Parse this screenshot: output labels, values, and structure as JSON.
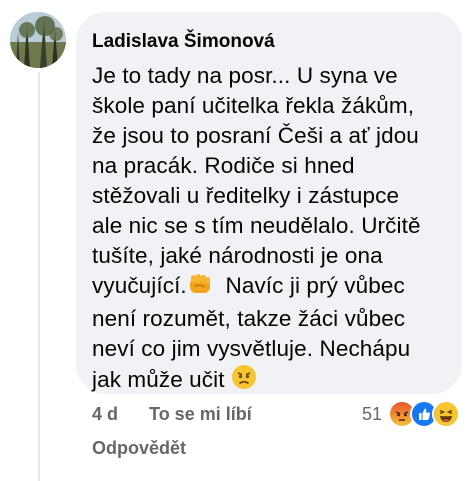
{
  "comment": {
    "author": "Ladislava Šimonová",
    "lines": [
      "Je to tady na posr... U syna ve",
      "škole paní učitelka řekla žákům,",
      "že jsou to posraní Češi a ať jdou",
      "na pracák. Rodiče si hned",
      "stěžovali u ředitelky i zástupce",
      "ale nic se s tím neudělalo. Určitě",
      "tušíte, jaké národnosti je ona",
      "vyučující.",
      "  Navíc ji prý vůbec",
      "není rozumět, takze žáci vůbec",
      "neví co jim vysvětluje. Nechápu",
      "jak může učit "
    ],
    "time": "4 d",
    "like_label": "To se mi líbí",
    "reply_label": "Odpovědět",
    "reaction_count": "51",
    "reaction_icons": [
      "angry-reaction-icon",
      "like-reaction-icon",
      "haha-reaction-icon"
    ],
    "inline_emojis": [
      "fist-emoji",
      "frowning-emoji"
    ]
  }
}
